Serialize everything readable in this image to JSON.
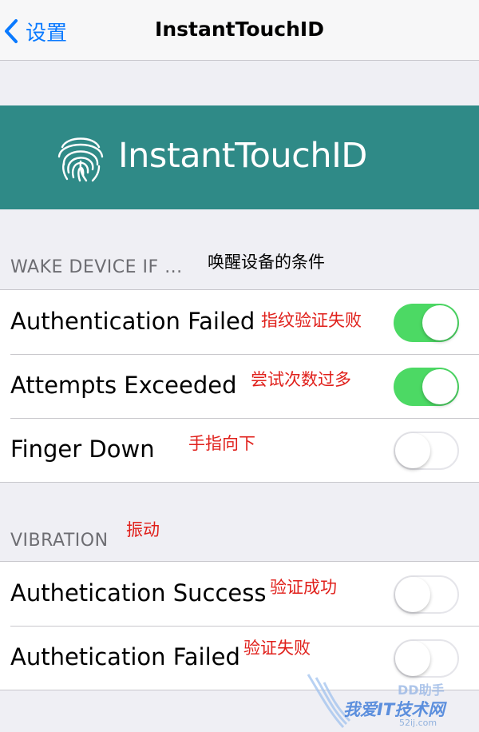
{
  "nav": {
    "back_label": "设置",
    "title": "InstantTouchID"
  },
  "banner": {
    "text": "InstantTouchID",
    "logo_icon": "fingerprint-icon",
    "color": "#2f8a87"
  },
  "wake_section": {
    "header": "WAKE DEVICE IF ...",
    "annotation": "唤醒设备的条件",
    "rows": [
      {
        "label": "Authentication Failed",
        "annotation": "指纹验证失败",
        "on": true
      },
      {
        "label": "Attempts Exceeded",
        "annotation": "尝试次数过多",
        "on": true
      },
      {
        "label": "Finger Down",
        "annotation": "手指向下",
        "on": false
      }
    ]
  },
  "vibration_section": {
    "header": "VIBRATION",
    "annotation": "振动",
    "rows": [
      {
        "label": "Authetication Success",
        "annotation": "验证成功",
        "on": false
      },
      {
        "label": "Authetication Failed",
        "annotation": "验证失败",
        "on": false
      }
    ]
  },
  "watermark": {
    "text": "我爱IT技术网",
    "site": "52ij.com",
    "brand": "DD助手"
  },
  "colors": {
    "accent": "#0a7aff",
    "toggle_on": "#4cd964",
    "annotation": "#e0201b"
  }
}
